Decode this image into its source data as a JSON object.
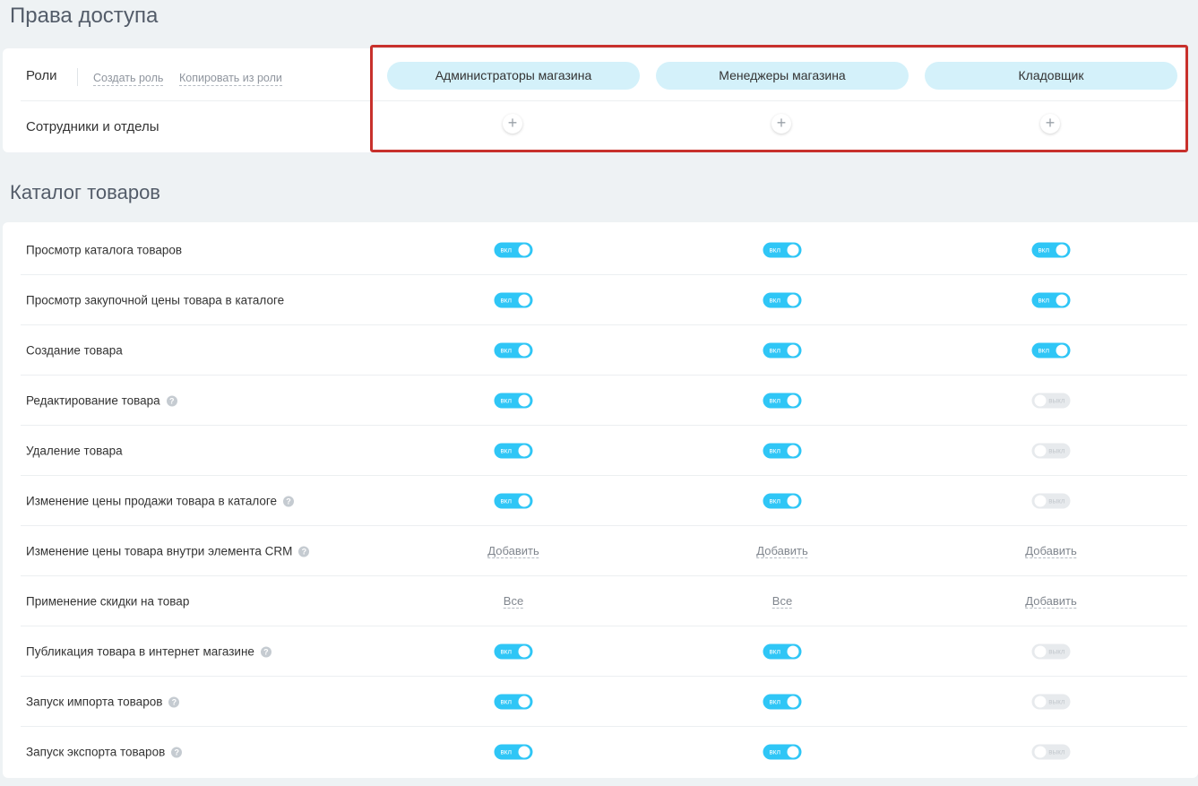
{
  "page_title": "Права доступа",
  "roles_section": {
    "roles_label": "Роли",
    "create_role": "Создать роль",
    "copy_from_role": "Копировать из роли",
    "employees_label": "Сотрудники и отделы",
    "add_symbol": "+",
    "roles": [
      "Администраторы магазина",
      "Менеджеры магазина",
      "Кладовщик"
    ]
  },
  "catalog_section": {
    "title": "Каталог товаров",
    "on_label": "вкл",
    "off_label": "выкл",
    "help_symbol": "?",
    "rows": [
      {
        "label": "Просмотр каталога товаров",
        "help": false,
        "cells": [
          {
            "type": "toggle",
            "on": true
          },
          {
            "type": "toggle",
            "on": true
          },
          {
            "type": "toggle",
            "on": true
          }
        ]
      },
      {
        "label": "Просмотр закупочной цены товара в каталоге",
        "help": false,
        "cells": [
          {
            "type": "toggle",
            "on": true
          },
          {
            "type": "toggle",
            "on": true
          },
          {
            "type": "toggle",
            "on": true
          }
        ]
      },
      {
        "label": "Создание товара",
        "help": false,
        "cells": [
          {
            "type": "toggle",
            "on": true
          },
          {
            "type": "toggle",
            "on": true
          },
          {
            "type": "toggle",
            "on": true
          }
        ]
      },
      {
        "label": "Редактирование товара",
        "help": true,
        "cells": [
          {
            "type": "toggle",
            "on": true
          },
          {
            "type": "toggle",
            "on": true
          },
          {
            "type": "toggle",
            "on": false
          }
        ]
      },
      {
        "label": "Удаление товара",
        "help": false,
        "cells": [
          {
            "type": "toggle",
            "on": true
          },
          {
            "type": "toggle",
            "on": true
          },
          {
            "type": "toggle",
            "on": false
          }
        ]
      },
      {
        "label": "Изменение цены продажи товара в каталоге",
        "help": true,
        "cells": [
          {
            "type": "toggle",
            "on": true
          },
          {
            "type": "toggle",
            "on": true
          },
          {
            "type": "toggle",
            "on": false
          }
        ]
      },
      {
        "label": "Изменение цены товара внутри элемента CRM",
        "help": true,
        "cells": [
          {
            "type": "link",
            "text": "Добавить"
          },
          {
            "type": "link",
            "text": "Добавить"
          },
          {
            "type": "link",
            "text": "Добавить"
          }
        ]
      },
      {
        "label": "Применение скидки на товар",
        "help": false,
        "cells": [
          {
            "type": "link",
            "text": "Все"
          },
          {
            "type": "link",
            "text": "Все"
          },
          {
            "type": "link",
            "text": "Добавить"
          }
        ]
      },
      {
        "label": "Публикация товара в интернет магазине",
        "help": true,
        "cells": [
          {
            "type": "toggle",
            "on": true
          },
          {
            "type": "toggle",
            "on": true
          },
          {
            "type": "toggle",
            "on": false
          }
        ]
      },
      {
        "label": "Запуск импорта товаров",
        "help": true,
        "cells": [
          {
            "type": "toggle",
            "on": true
          },
          {
            "type": "toggle",
            "on": true
          },
          {
            "type": "toggle",
            "on": false
          }
        ]
      },
      {
        "label": "Запуск экспорта товаров",
        "help": true,
        "cells": [
          {
            "type": "toggle",
            "on": true
          },
          {
            "type": "toggle",
            "on": true
          },
          {
            "type": "toggle",
            "on": false
          }
        ]
      }
    ]
  },
  "colors": {
    "toggle_on": "#2fc6f6",
    "toggle_off": "#e7eaed",
    "role_pill": "#d4f1fa",
    "highlight_border": "#c8312c"
  }
}
